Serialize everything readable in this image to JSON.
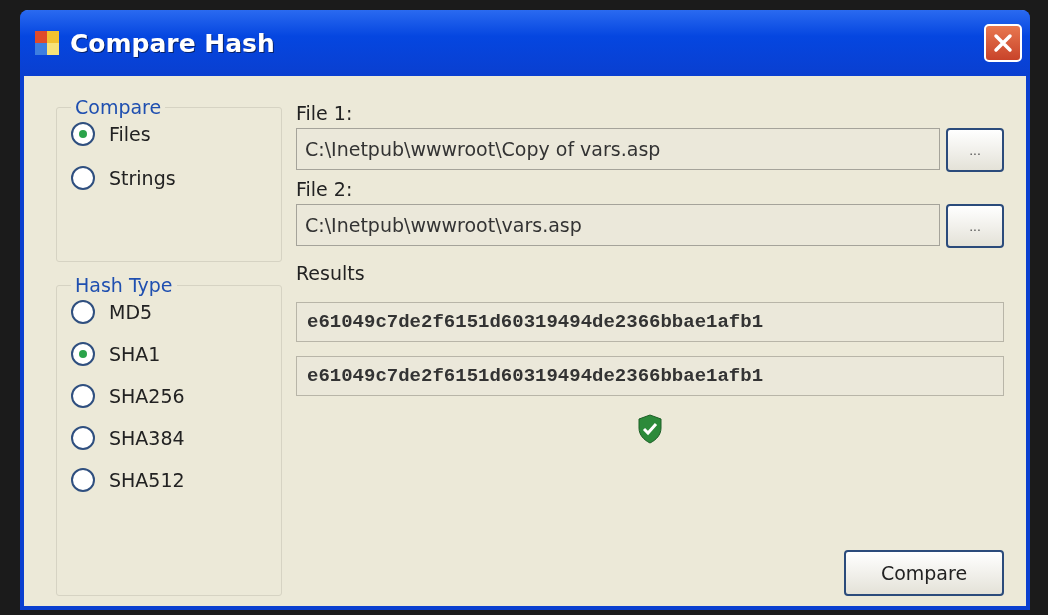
{
  "window": {
    "title": "Compare Hash"
  },
  "compare": {
    "title": "Compare",
    "options": [
      {
        "label": "Files",
        "selected": true
      },
      {
        "label": "Strings",
        "selected": false
      }
    ]
  },
  "hash_type": {
    "title": "Hash Type",
    "options": [
      {
        "label": "MD5",
        "selected": false
      },
      {
        "label": "SHA1",
        "selected": true
      },
      {
        "label": "SHA256",
        "selected": false
      },
      {
        "label": "SHA384",
        "selected": false
      },
      {
        "label": "SHA512",
        "selected": false
      }
    ]
  },
  "files": [
    {
      "label": "File 1:",
      "value": "C:\\Inetpub\\wwwroot\\Copy of vars.asp",
      "browse": "..."
    },
    {
      "label": "File 2:",
      "value": "C:\\Inetpub\\wwwroot\\vars.asp",
      "browse": "..."
    }
  ],
  "results": {
    "label": "Results",
    "values": [
      "e61049c7de2f6151d60319494de2366bbae1afb1",
      "e61049c7de2f6151d60319494de2366bbae1afb1"
    ],
    "match": true
  },
  "compare_button": "Compare"
}
